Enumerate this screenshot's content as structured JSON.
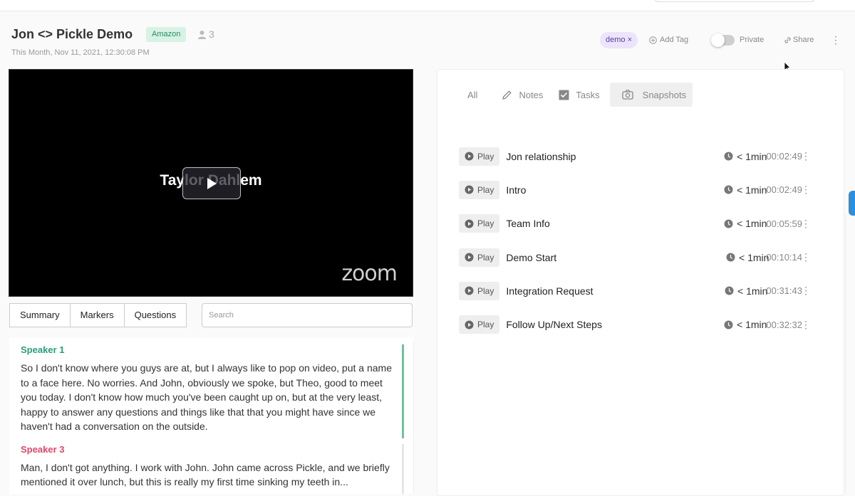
{
  "header": {
    "title": "Jon <> Pickle Demo",
    "company_tag": "Amazon",
    "participants_count": "3",
    "date": "This Month, Nov 11, 2021, 12:30:08 PM",
    "tag_chip": "demo",
    "tag_chip_remove": "×",
    "add_tag": "Add Tag",
    "private_label": "Private",
    "private_on": false,
    "share_label": "Share"
  },
  "video": {
    "speaker_name": "Taylor Dahlem",
    "brand": "zoom"
  },
  "left_tabs": [
    "Summary",
    "Markers",
    "Questions"
  ],
  "search": {
    "placeholder": "Search"
  },
  "transcript": [
    {
      "speaker": "Speaker 1",
      "color": "#2a9d7a",
      "active": true,
      "text": "So I don't know where you guys are at, but I always like to pop on video, put a name to a face here. No worries. And John, obviously we spoke, but Theo, good to meet you today. I don't know how much you've been caught up on, but at the very least, happy to answer any questions and things like that that you might have since we haven't had a conversation on the outside."
    },
    {
      "speaker": "Speaker 3",
      "color": "#e0466a",
      "active": false,
      "text": "Man, I don't got anything. I work with John. John came across Pickle, and we briefly mentioned it over lunch, but this is really my first time sinking my teeth in..."
    }
  ],
  "right_tabs": [
    {
      "label": "All",
      "icon": "",
      "active": false
    },
    {
      "label": "Notes",
      "icon": "pencil-icon",
      "active": false
    },
    {
      "label": "Tasks",
      "icon": "checkbox-icon",
      "active": false
    },
    {
      "label": "Snapshots",
      "icon": "camera-icon",
      "active": true
    }
  ],
  "snapshots": {
    "play_label": "Play",
    "items": [
      {
        "title": "Jon relationship",
        "duration": "< 1min",
        "timestamp": "00:02:49"
      },
      {
        "title": "Intro",
        "duration": "< 1min",
        "timestamp": "00:02:49"
      },
      {
        "title": "Team Info",
        "duration": "< 1min",
        "timestamp": "00:05:59"
      },
      {
        "title": "Demo Start",
        "duration": "< 1min",
        "timestamp": "00:10:14"
      },
      {
        "title": "Integration Request",
        "duration": "< 1min",
        "timestamp": "00:31:43"
      },
      {
        "title": "Follow Up/Next Steps",
        "duration": "< 1min",
        "timestamp": "00:32:32"
      }
    ]
  },
  "colors": {
    "accent_green": "#6cc39a",
    "tag_purple_bg": "#ece4fb",
    "amazon_tag_bg": "#d8f2e5",
    "edge_tab_blue": "#2b8fe0"
  }
}
